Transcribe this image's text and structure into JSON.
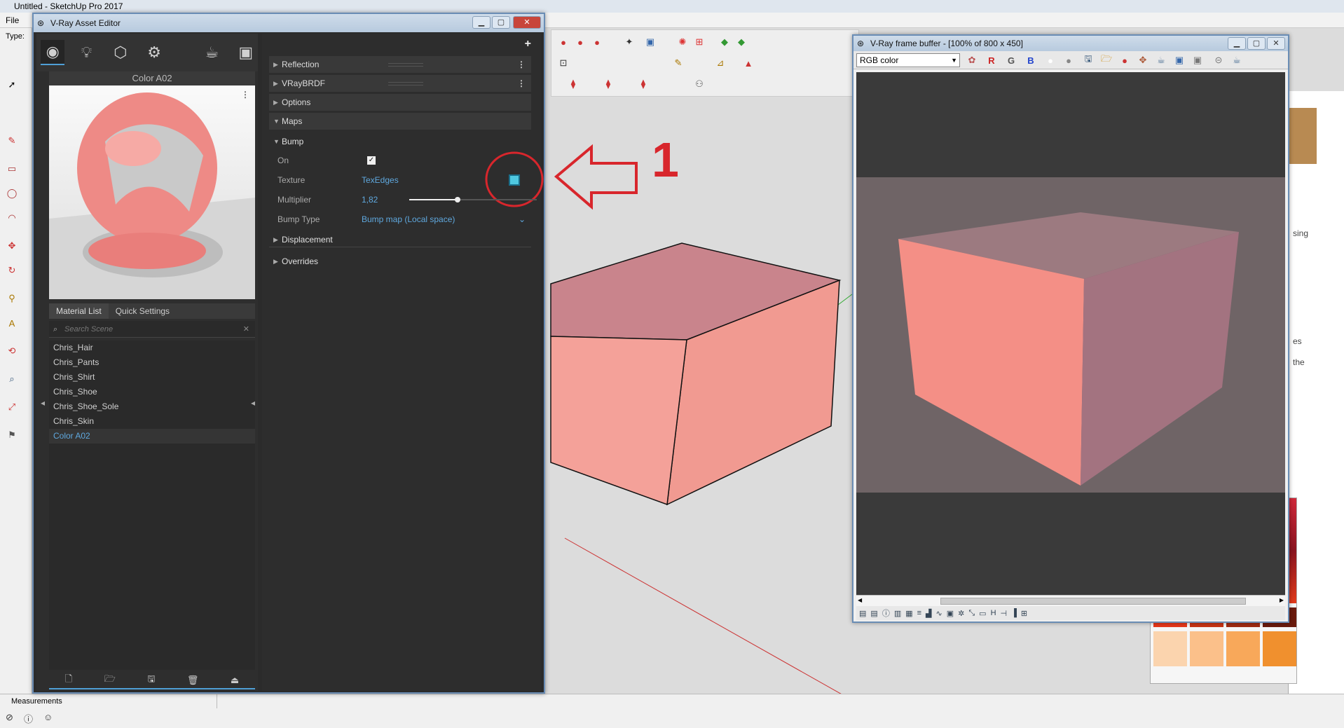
{
  "sketchup": {
    "title": "Untitled - SketchUp Pro 2017",
    "menu_file": "File",
    "type_label": "Type:",
    "measurements_label": "Measurements",
    "right_panel_texts": [
      "sing",
      "es",
      "the"
    ]
  },
  "asset_editor": {
    "title": "V-Ray Asset Editor",
    "material_name": "Color A02",
    "tabs": [
      "Material List",
      "Quick Settings"
    ],
    "search_placeholder": "Search Scene",
    "materials": [
      "Chris_Hair",
      "Chris_Pants",
      "Chris_Shirt",
      "Chris_Shoe",
      "Chris_Shoe_Sole",
      "Chris_Skin",
      "Color A02"
    ],
    "selected_material": "Color A02",
    "sections": {
      "reflection": "Reflection",
      "vraybrdf": "VRayBRDF",
      "options": "Options",
      "maps": "Maps",
      "bump": "Bump",
      "displacement": "Displacement",
      "overrides": "Overrides"
    },
    "bump": {
      "on_label": "On",
      "texture_label": "Texture",
      "texture_value": "TexEdges",
      "multiplier_label": "Multiplier",
      "multiplier_value": "1,82",
      "multiplier_fraction": 0.38,
      "bump_type_label": "Bump Type",
      "bump_type_value": "Bump map (Local space)"
    }
  },
  "annotation": {
    "number": "1",
    "color": "#d8262c"
  },
  "frame_buffer": {
    "title": "V-Ray frame buffer - [100% of 800 x 450]",
    "channel": "RGB color",
    "channel_buttons": [
      "R",
      "G",
      "B"
    ],
    "status_h": "H"
  },
  "colors": {
    "accent_blue": "#5fa8de",
    "cube_pink": "#f0908a",
    "editor_bg": "#2d2d2d"
  }
}
